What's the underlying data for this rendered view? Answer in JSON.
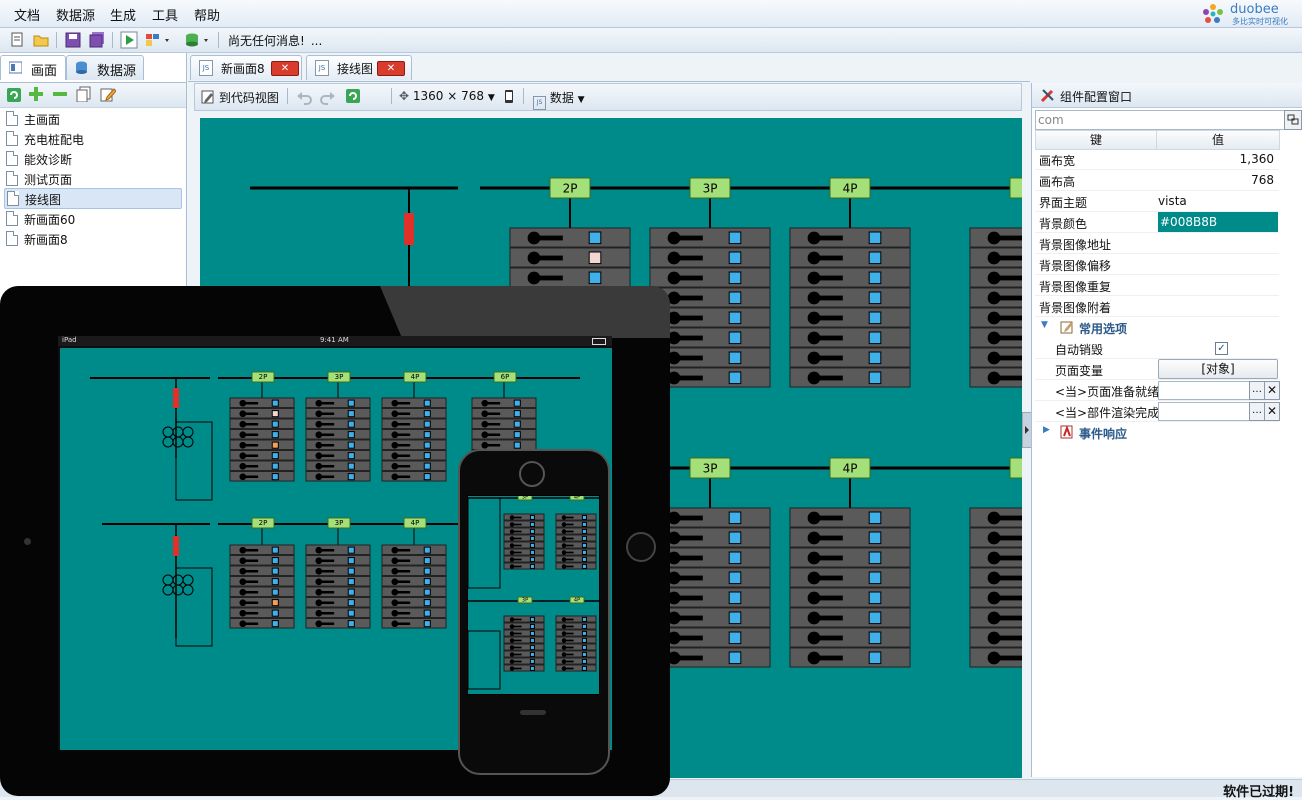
{
  "menu": [
    "文档",
    "数据源",
    "生成",
    "工具",
    "帮助"
  ],
  "logo": {
    "brand": "duobee",
    "tagline": "多比实时可视化"
  },
  "toolbar": {
    "status_message": "尚无任何消息!",
    "more": "..."
  },
  "left_tabs": [
    {
      "label": "画面"
    },
    {
      "label": "数据源"
    }
  ],
  "tree_items": [
    "主画面",
    "充电桩配电",
    "能效诊断",
    "测试页面",
    "接线图",
    "新画面60",
    "新画面8"
  ],
  "selected_tree_item": "接线图",
  "editor_tabs": [
    {
      "label": "新画面8",
      "icon": "JS"
    },
    {
      "label": "接线图",
      "icon": "JS"
    }
  ],
  "canvas_toolbar": {
    "code_view": "到代码视图",
    "resolution": "1360 × 768",
    "data_menu": "数据"
  },
  "canvas": {
    "background": "#008B8B",
    "bus_labels_top": [
      "2P",
      "3P",
      "4P",
      "6P"
    ],
    "bus_labels_bottom": [
      "3P",
      "4P",
      "6P"
    ]
  },
  "right_panel": {
    "title": "组件配置窗口",
    "search_value": "com",
    "col_key": "键",
    "col_value": "值",
    "rows": [
      {
        "key": "画布宽",
        "value": "1,360"
      },
      {
        "key": "画布高",
        "value": "768"
      },
      {
        "key": "界面主题",
        "value": "vista"
      },
      {
        "key": "背景颜色",
        "value": "#008B8B"
      },
      {
        "key": "背景图像地址",
        "value": ""
      },
      {
        "key": "背景图像偏移",
        "value": ""
      },
      {
        "key": "背景图像重复",
        "value": ""
      },
      {
        "key": "背景图像附着",
        "value": ""
      }
    ],
    "group_common": "常用选项",
    "auto_destroy": "自动销毁",
    "auto_destroy_checked": true,
    "page_var": "页面变量",
    "page_var_value": "[对象]",
    "on_ready": "<当>页面准备就绪",
    "on_rendered": "<当>部件渲染完成",
    "group_events": "事件响应"
  },
  "devices": {
    "ipad_carrier": "iPad",
    "ipad_time": "9:41 AM"
  },
  "status_bar": {
    "expired": "软件已过期!"
  },
  "colors": {
    "accent": "#3a7cc1",
    "canvas": "#008B8B",
    "label_green": "#a4e07a",
    "red_close": "#d93c2c"
  }
}
